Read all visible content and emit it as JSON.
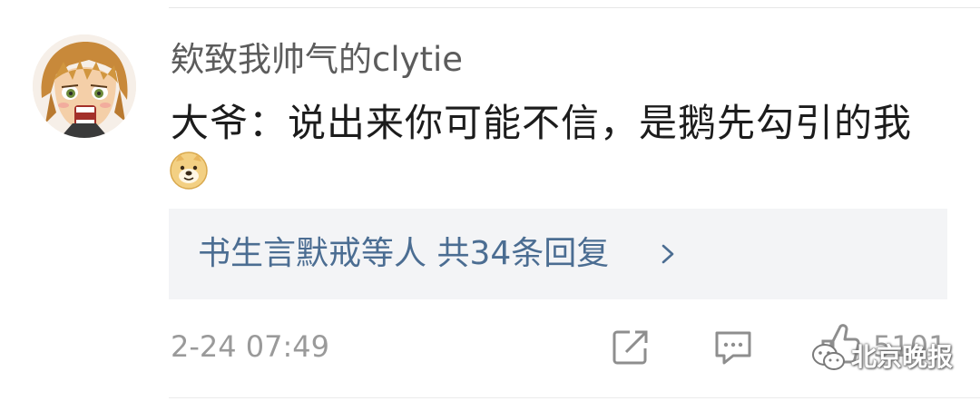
{
  "comment": {
    "username": "欸致我帅气的clytie",
    "text": "大爷：说出来你可能不信，是鹅先勾引的我",
    "emoji_icon": "doge-emoji-icon",
    "replies": {
      "summary": "书生言默戒等人  共34条回复"
    },
    "timestamp": "2-24 07:49",
    "actions": {
      "share_icon": "share-icon",
      "comment_icon": "comment-icon",
      "like_icon": "thumbs-up-icon",
      "like_count": "5101"
    }
  },
  "watermark": {
    "text": "北京晚报",
    "icon": "wechat-icon"
  },
  "colors": {
    "username": "#5c5c5c",
    "text": "#1c1c1c",
    "reply_link": "#4b6d92",
    "reply_bg": "#f3f4f6",
    "meta": "#9a9a9a"
  }
}
